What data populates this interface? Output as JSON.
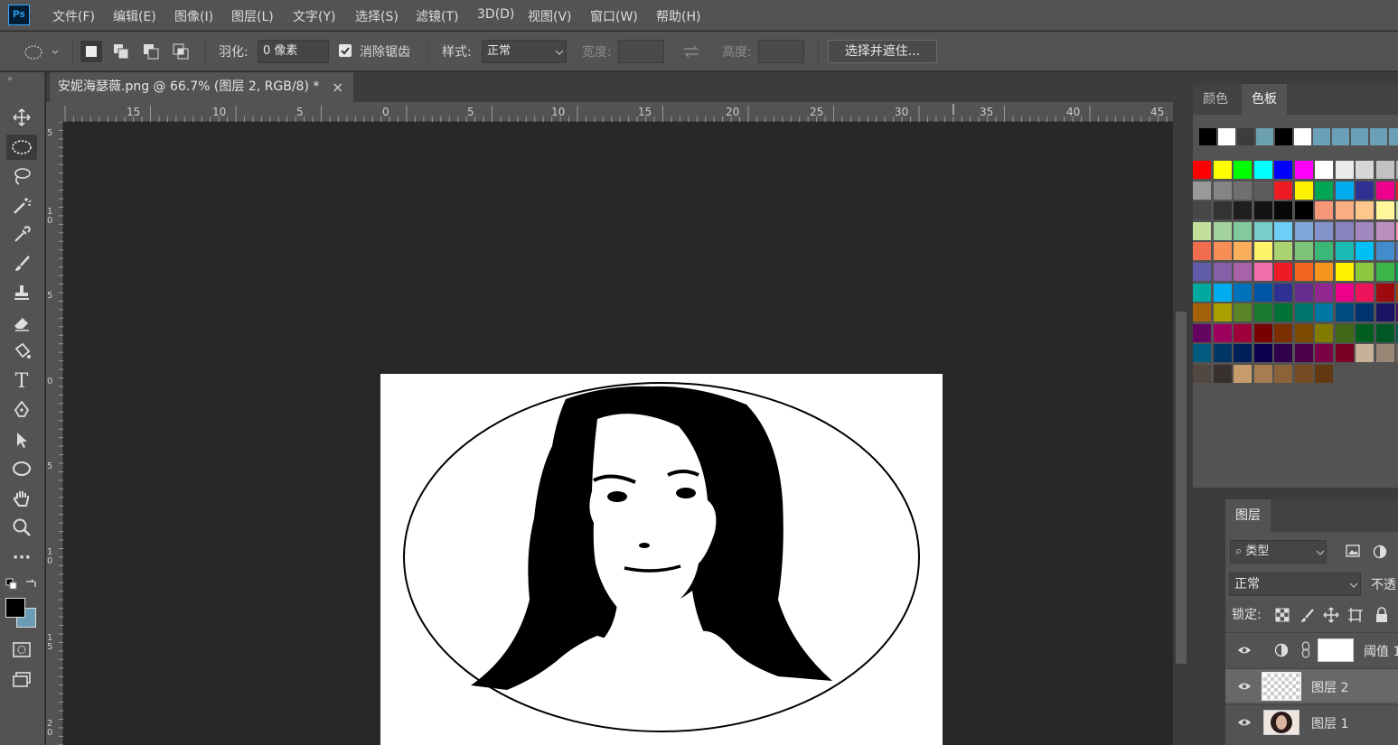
{
  "app": {
    "logo": "Ps"
  },
  "menu": [
    "文件(F)",
    "编辑(E)",
    "图像(I)",
    "图层(L)",
    "文字(Y)",
    "选择(S)",
    "滤镜(T)",
    "3D(D)",
    "视图(V)",
    "窗口(W)",
    "帮助(H)"
  ],
  "options": {
    "feather_label": "羽化:",
    "feather_value": "0 像素",
    "antialias_label": "消除锯齿",
    "antialias_checked": true,
    "style_label": "样式:",
    "style_value": "正常",
    "width_label": "宽度:",
    "height_label": "高度:",
    "select_mask_label": "选择并遮住..."
  },
  "document": {
    "tab_title": "安妮海瑟薇.png @ 66.7% (图层 2, RGB/8) *",
    "close": "×"
  },
  "ruler_h": [
    "15",
    "10",
    "5",
    "0",
    "5",
    "10",
    "15",
    "20",
    "25",
    "30",
    "35",
    "40",
    "45"
  ],
  "ruler_v": [
    "5",
    "1\n0",
    "5",
    "0",
    "5",
    "1\n0",
    "1\n5",
    "2\n0"
  ],
  "panels": {
    "color_tab": "颜色",
    "swatches_tab": "色板",
    "recent_swatches": [
      "#000000",
      "#ffffff",
      "#3c3c3c",
      "#6aa0b0",
      "#000000",
      "#ffffff",
      "#6aa0b8",
      "#6aa0b8",
      "#6aa0b8",
      "#6aa0b8",
      "#6aa0b8"
    ],
    "swatches": [
      [
        "#ff0000",
        "#ffff00",
        "#00ff00",
        "#00ffff",
        "#0000ff",
        "#ff00ff",
        "#ffffff",
        "#ebebeb",
        "#d6d6d6",
        "#c2c2c2",
        "#adadad"
      ],
      [
        "#999999",
        "#858585",
        "#707070",
        "#5c5c5c",
        "#ed1c24",
        "#fff200",
        "#00a651",
        "#00aeef",
        "#2e3192",
        "#ec008c",
        "#ed1c24"
      ],
      [
        "#474747",
        "#333333",
        "#1f1f1f",
        "#141414",
        "#080808",
        "#000000",
        "#f7977a",
        "#f9ad81",
        "#fdc68a",
        "#fff79a",
        "#c4df9b"
      ],
      [
        "#c4df9b",
        "#a3d39c",
        "#82ca9c",
        "#7accc8",
        "#6dcff6",
        "#7ea7d8",
        "#8493ca",
        "#8882be",
        "#a187be",
        "#bc8dbf",
        "#f49ac1"
      ],
      [
        "#f26c4f",
        "#f68e55",
        "#fbaf5c",
        "#fff467",
        "#acd372",
        "#7cc576",
        "#3bb878",
        "#1abbb4",
        "#00bff3",
        "#438ccb",
        "#5574b9"
      ],
      [
        "#605ca8",
        "#855fa8",
        "#a763a8",
        "#f06ea9",
        "#ed1c24",
        "#f26522",
        "#f7941d",
        "#fff200",
        "#8dc73f",
        "#39b54a",
        "#00a651"
      ],
      [
        "#00a99d",
        "#00aeef",
        "#0072bc",
        "#0054a6",
        "#2e3192",
        "#662d91",
        "#92278f",
        "#ec008c",
        "#ed145b",
        "#9e0b0f",
        "#a0410d"
      ],
      [
        "#a36209",
        "#aba000",
        "#598527",
        "#1a7b30",
        "#007236",
        "#00746b",
        "#0076a3",
        "#004b80",
        "#003471",
        "#1b1464",
        "#440e62"
      ],
      [
        "#630460",
        "#9e005d",
        "#9e0039",
        "#790000",
        "#7b2e00",
        "#7d4900",
        "#827b00",
        "#406618",
        "#005e20",
        "#005826",
        "#005952"
      ],
      [
        "#005b7f",
        "#003663",
        "#002157",
        "#0d004c",
        "#32004b",
        "#4b0049",
        "#7b0046",
        "#7a0026",
        "#c7b299",
        "#998675",
        "#736357"
      ],
      [
        "#534741",
        "#37302d",
        "#c69c6d",
        "#a67c52",
        "#8c6239",
        "#754c24",
        "#603913"
      ]
    ]
  },
  "layers": {
    "tab": "图层",
    "filter_label": "类型",
    "blend_mode": "正常",
    "opacity_label": "不透",
    "lock_label": "锁定:",
    "rows": [
      {
        "name": "阈值 1"
      },
      {
        "name": "图层 2"
      },
      {
        "name": "图层 1"
      }
    ]
  }
}
